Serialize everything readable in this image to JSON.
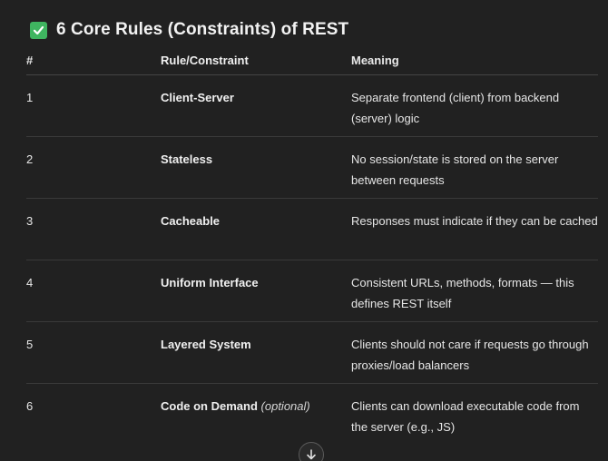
{
  "heading": {
    "icon": "check-box-icon",
    "text": "6 Core Rules (Constraints) of REST"
  },
  "table": {
    "headers": [
      "#",
      "Rule/Constraint",
      "Meaning"
    ],
    "rows": [
      {
        "num": "1",
        "rule": "Client-Server",
        "note": "",
        "meaning": "Separate frontend (client) from backend (server) logic"
      },
      {
        "num": "2",
        "rule": "Stateless",
        "note": "",
        "meaning": "No session/state is stored on the server between requests"
      },
      {
        "num": "3",
        "rule": "Cacheable",
        "note": "",
        "meaning": "Responses must indicate if they can be cached"
      },
      {
        "num": "4",
        "rule": "Uniform Interface",
        "note": "",
        "meaning": "Consistent URLs, methods, formats — this defines REST itself"
      },
      {
        "num": "5",
        "rule": "Layered System",
        "note": "",
        "meaning": "Clients should not care if requests go through proxies/load balancers"
      },
      {
        "num": "6",
        "rule": "Code on Demand",
        "note": "(optional)",
        "meaning": "Clients can download executable code from the server (e.g., JS)"
      }
    ]
  },
  "scroll_button": {
    "icon": "arrow-down-icon"
  },
  "colors": {
    "background": "#212121",
    "check_green": "#3fb560",
    "text": "#ececec"
  }
}
